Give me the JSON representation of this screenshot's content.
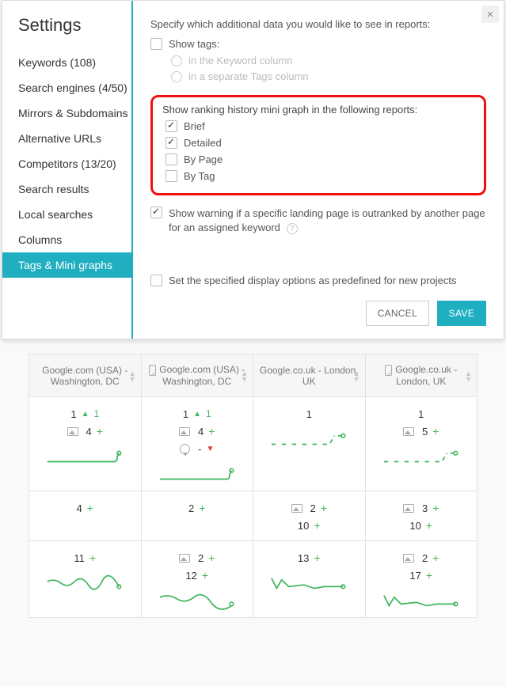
{
  "modal": {
    "title": "Settings",
    "sidebar": [
      {
        "label": "Keywords (108)"
      },
      {
        "label": "Search engines (4/50)"
      },
      {
        "label": "Mirrors & Subdomains"
      },
      {
        "label": "Alternative URLs"
      },
      {
        "label": "Competitors (13/20)"
      },
      {
        "label": "Search results"
      },
      {
        "label": "Local searches"
      },
      {
        "label": "Columns"
      },
      {
        "label": "Tags & Mini graphs",
        "active": true
      }
    ],
    "intro": "Specify which additional data you would like to see in reports:",
    "show_tags_label": "Show tags:",
    "tags_options": [
      "in the Keyword column",
      "in a separate Tags column"
    ],
    "callout": {
      "title": "Show ranking history mini graph in the following reports:",
      "items": [
        {
          "label": "Brief",
          "checked": true
        },
        {
          "label": "Detailed",
          "checked": true
        },
        {
          "label": "By Page",
          "checked": false
        },
        {
          "label": "By Tag",
          "checked": false
        }
      ]
    },
    "warning_label": "Show warning if a specific landing page is outranked by another page for an assigned keyword",
    "warning_checked": true,
    "predefined_label": "Set the specified display options as predefined for new projects",
    "predefined_checked": false,
    "cancel": "CANCEL",
    "save": "SAVE"
  },
  "table": {
    "headers": [
      {
        "label": "Google.com (USA) - Washington, DC",
        "mobile": false
      },
      {
        "label": "Google.com (USA) - Washington, DC",
        "mobile": true
      },
      {
        "label": "Google.co.uk - London, UK",
        "mobile": false
      },
      {
        "label": "Google.co.uk - London, UK",
        "mobile": true
      }
    ],
    "rows": [
      {
        "cells": [
          {
            "lines": [
              {
                "val": "1",
                "trend_dir": "up",
                "trend_val": "1"
              },
              {
                "pic": true,
                "val": "4",
                "plus": true
              }
            ],
            "spark": "flat-up"
          },
          {
            "lines": [
              {
                "val": "1",
                "trend_dir": "up",
                "trend_val": "1"
              },
              {
                "pic": true,
                "val": "4",
                "plus": true
              },
              {
                "badge": true,
                "val": "-",
                "down": true
              }
            ],
            "spark": "flat-up"
          },
          {
            "lines": [
              {
                "val": "1"
              }
            ],
            "spark": "gap-up"
          },
          {
            "lines": [
              {
                "val": "1"
              },
              {
                "pic": true,
                "val": "5",
                "plus": true
              }
            ],
            "spark": "gap-up"
          }
        ]
      },
      {
        "cells": [
          {
            "lines": [
              {
                "val": "4",
                "plus": true
              }
            ]
          },
          {
            "lines": [
              {
                "val": "2",
                "plus": true
              }
            ]
          },
          {
            "lines": [
              {
                "pic": true,
                "val": "2",
                "plus": true
              },
              {
                "val": "10",
                "plus": true
              }
            ]
          },
          {
            "lines": [
              {
                "pic": true,
                "val": "3",
                "plus": true
              },
              {
                "val": "10",
                "plus": true
              }
            ]
          }
        ]
      },
      {
        "cells": [
          {
            "lines": [
              {
                "val": "11",
                "plus": true
              }
            ],
            "spark": "wiggle"
          },
          {
            "lines": [
              {
                "pic": true,
                "val": "2",
                "plus": true
              },
              {
                "val": "12",
                "plus": true
              }
            ],
            "spark": "wiggle-down"
          },
          {
            "lines": [
              {
                "val": "13",
                "plus": true
              }
            ],
            "spark": "jag"
          },
          {
            "lines": [
              {
                "pic": true,
                "val": "2",
                "plus": true
              },
              {
                "val": "17",
                "plus": true
              }
            ],
            "spark": "jag"
          }
        ]
      }
    ]
  }
}
